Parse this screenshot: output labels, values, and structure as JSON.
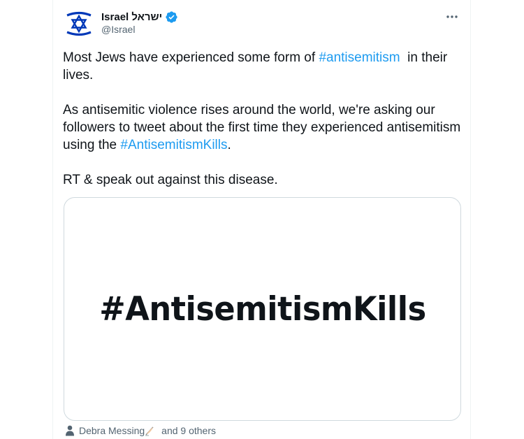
{
  "account": {
    "display_name": "Israel ישראל",
    "handle": "@Israel",
    "avatar_icon": "star-of-david-icon",
    "verified_icon": "verified-badge-icon"
  },
  "menu": {
    "icon": "more-horizontal-icon"
  },
  "tweet": {
    "paragraph1_before": "Most Jews have experienced some form of ",
    "paragraph1_hashtag": "#antisemitism",
    "paragraph1_after": "  in their lives.",
    "paragraph2_before": "As antisemitic violence rises around the world, we're asking our followers to tweet about the first time they experienced antisemitism using the ",
    "paragraph2_hashtag": "#AntisemitismKills",
    "paragraph2_after": ".",
    "paragraph3": "RT & speak out against this disease."
  },
  "media": {
    "text": "#AntisemitismKills"
  },
  "social_context": {
    "icon": "person-icon",
    "liker_name": "Debra Messing",
    "liker_emoji": "writing-hand-icon",
    "others_text": "and 9 others"
  },
  "colors": {
    "link": "#1d9bf0",
    "verified": "#1d9bf0",
    "flag_blue": "#0038b8",
    "secondary_text": "#536471"
  }
}
